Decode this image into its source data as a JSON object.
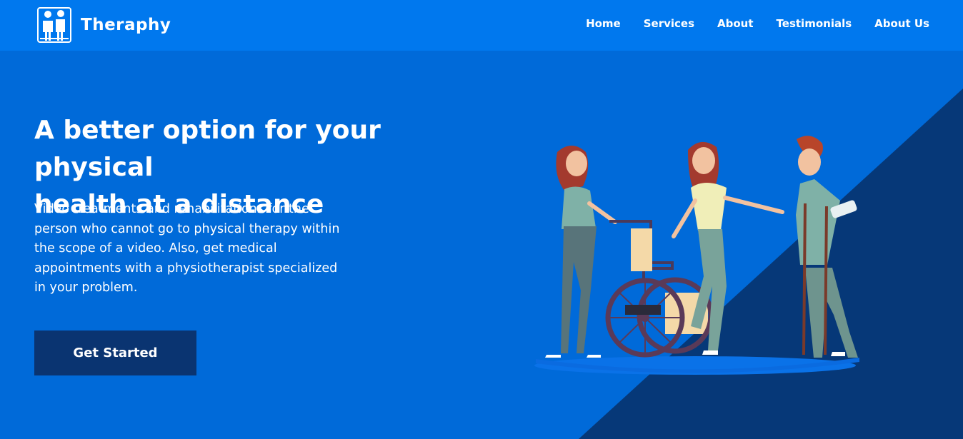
{
  "brand": {
    "name": "Theraphy",
    "logo_icon": "therapy-people-icon"
  },
  "nav": {
    "items": [
      {
        "label": "Home"
      },
      {
        "label": "Services"
      },
      {
        "label": "About"
      },
      {
        "label": "Testimonials"
      },
      {
        "label": "About Us"
      }
    ]
  },
  "hero": {
    "title_line1": "A better option for your physical",
    "title_line2": "health at a distance",
    "description": "Video treatments and rehabilitations for the person who cannot go to physical therapy within the scope of a video. Also, get medical appointments with a physiotherapist specialized in your problem.",
    "cta_label": "Get Started",
    "illustration": "physiotherapy-team-illustration"
  },
  "colors": {
    "navbar": "#0078ee",
    "hero": "#006ad9",
    "diagonal": "#063878",
    "button": "#0a3471"
  }
}
